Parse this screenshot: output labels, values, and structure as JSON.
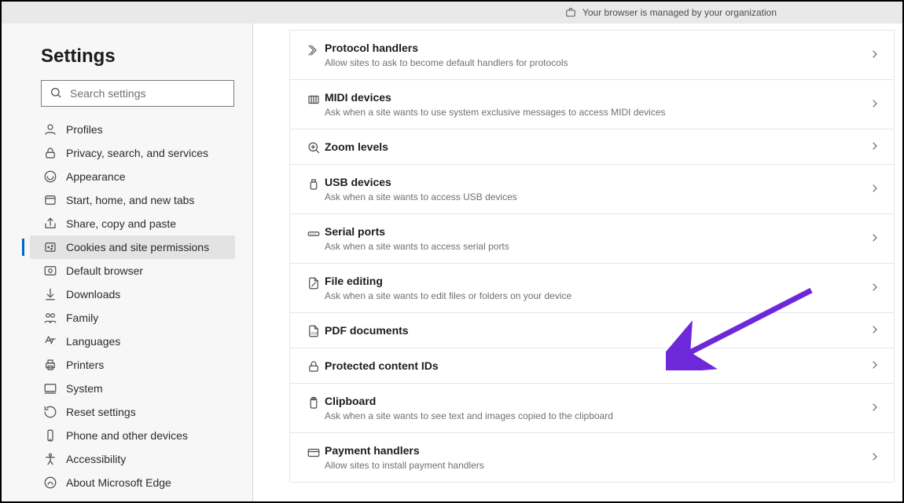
{
  "topbar": {
    "managed_text": "Your browser is managed by your organization"
  },
  "sidebar": {
    "heading": "Settings",
    "search_placeholder": "Search settings",
    "items": [
      {
        "key": "profiles",
        "label": "Profiles",
        "active": false
      },
      {
        "key": "privacy",
        "label": "Privacy, search, and services",
        "active": false
      },
      {
        "key": "appearance",
        "label": "Appearance",
        "active": false
      },
      {
        "key": "start",
        "label": "Start, home, and new tabs",
        "active": false
      },
      {
        "key": "share",
        "label": "Share, copy and paste",
        "active": false
      },
      {
        "key": "cookies",
        "label": "Cookies and site permissions",
        "active": true
      },
      {
        "key": "default",
        "label": "Default browser",
        "active": false
      },
      {
        "key": "downloads",
        "label": "Downloads",
        "active": false
      },
      {
        "key": "family",
        "label": "Family",
        "active": false
      },
      {
        "key": "languages",
        "label": "Languages",
        "active": false
      },
      {
        "key": "printers",
        "label": "Printers",
        "active": false
      },
      {
        "key": "system",
        "label": "System",
        "active": false
      },
      {
        "key": "reset",
        "label": "Reset settings",
        "active": false
      },
      {
        "key": "phone",
        "label": "Phone and other devices",
        "active": false
      },
      {
        "key": "accessibility",
        "label": "Accessibility",
        "active": false
      },
      {
        "key": "about",
        "label": "About Microsoft Edge",
        "active": false
      }
    ]
  },
  "permissions": [
    {
      "key": "protocol",
      "title": "Protocol handlers",
      "desc": "Allow sites to ask to become default handlers for protocols"
    },
    {
      "key": "midi",
      "title": "MIDI devices",
      "desc": "Ask when a site wants to use system exclusive messages to access MIDI devices"
    },
    {
      "key": "zoom",
      "title": "Zoom levels",
      "desc": ""
    },
    {
      "key": "usb",
      "title": "USB devices",
      "desc": "Ask when a site wants to access USB devices"
    },
    {
      "key": "serial",
      "title": "Serial ports",
      "desc": "Ask when a site wants to access serial ports"
    },
    {
      "key": "fileedit",
      "title": "File editing",
      "desc": "Ask when a site wants to edit files or folders on your device"
    },
    {
      "key": "pdf",
      "title": "PDF documents",
      "desc": ""
    },
    {
      "key": "protected",
      "title": "Protected content IDs",
      "desc": ""
    },
    {
      "key": "clipboard",
      "title": "Clipboard",
      "desc": "Ask when a site wants to see text and images copied to the clipboard"
    },
    {
      "key": "payment",
      "title": "Payment handlers",
      "desc": "Allow sites to install payment handlers"
    }
  ],
  "annotation_arrow": {
    "color": "#6d28d9",
    "target_row_key": "pdf"
  }
}
